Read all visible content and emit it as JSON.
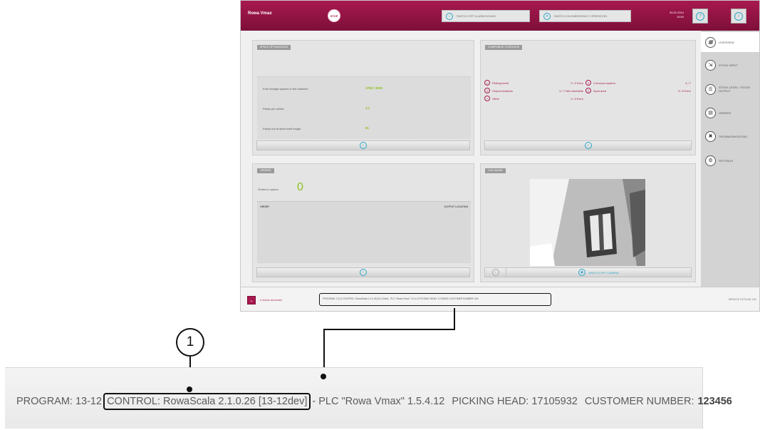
{
  "topbar": {
    "title": "Rowa Vmax",
    "stop_label": "STOP",
    "alarm_button": "SWITCH OFF ALARM SOUND",
    "emergency_button": "SWITCH ON EMERGENCY OPERATION",
    "date": "30.01.2014",
    "time": "10:54"
  },
  "space_optimization": {
    "title": "SPACE OPTIMIZATION",
    "rows": [
      {
        "label": "Free storage spaces in the machine",
        "value": "3769 / 3926"
      },
      {
        "label": "Packs per article",
        "value": "3,1"
      },
      {
        "label": "Packs not at ideal shelf height",
        "value": "81"
      }
    ]
  },
  "component_overview": {
    "title": "COMPONENT OVERVIEW",
    "left": [
      {
        "label": "Picking head",
        "status": "2 / 2 Error"
      },
      {
        "label": "Output locations",
        "status": "4 / 7 Not reachable"
      },
      {
        "label": "Other",
        "status": "2 / 3 Error"
      }
    ],
    "right": [
      {
        "label": "Conveyor system",
        "status": "4 / 7"
      },
      {
        "label": "Input area",
        "status": "5 / 6 Error"
      }
    ]
  },
  "orders": {
    "title": "ORDERS",
    "queue_label": "Orders in queue",
    "queue_value": "0",
    "col_order": "ORDER",
    "col_output": "OUTPUT LOCATION"
  },
  "live_image": {
    "title": "LIVE IMAGE",
    "camera_button": "SWITCH OFF CAMERA"
  },
  "sidebar": {
    "items": [
      {
        "label": "OVERVIEW"
      },
      {
        "label": "STOCK INPUT"
      },
      {
        "label": "STOCK LEVEL / STOCK OUTPUT"
      },
      {
        "label": "ORDERS"
      },
      {
        "label": "TROUBLESHOOTING"
      },
      {
        "label": "SETTINGS"
      }
    ]
  },
  "status_bar": {
    "errors": "2 errors occurred",
    "version_small": "PROGRAM: 13-12   CONTROL: RowaScala 2.1.0.26 [13-12dev] - PLC \"Rowa Vmax\" 1.5.4.12   PICKING HEAD: 17105932   CUSTOMER NUMBER: N/A",
    "service_hotline": "SERVICE HOTLINE: N/A"
  },
  "callout": {
    "number": "1"
  },
  "zoom": {
    "program": "PROGRAM: 13-12",
    "control": "CONTROL: RowaScala 2.1.0.26 [13-12dev]",
    "plc": "- PLC \"Rowa Vmax\" 1.5.4.12",
    "picking_head": "PICKING HEAD: 17105932",
    "customer_label": "CUSTOMER NUMBER:",
    "customer_value": "123456"
  },
  "colors": {
    "brand": "#a8194f",
    "accent": "#2aa6c8",
    "value_green": "#8fbf1f"
  }
}
